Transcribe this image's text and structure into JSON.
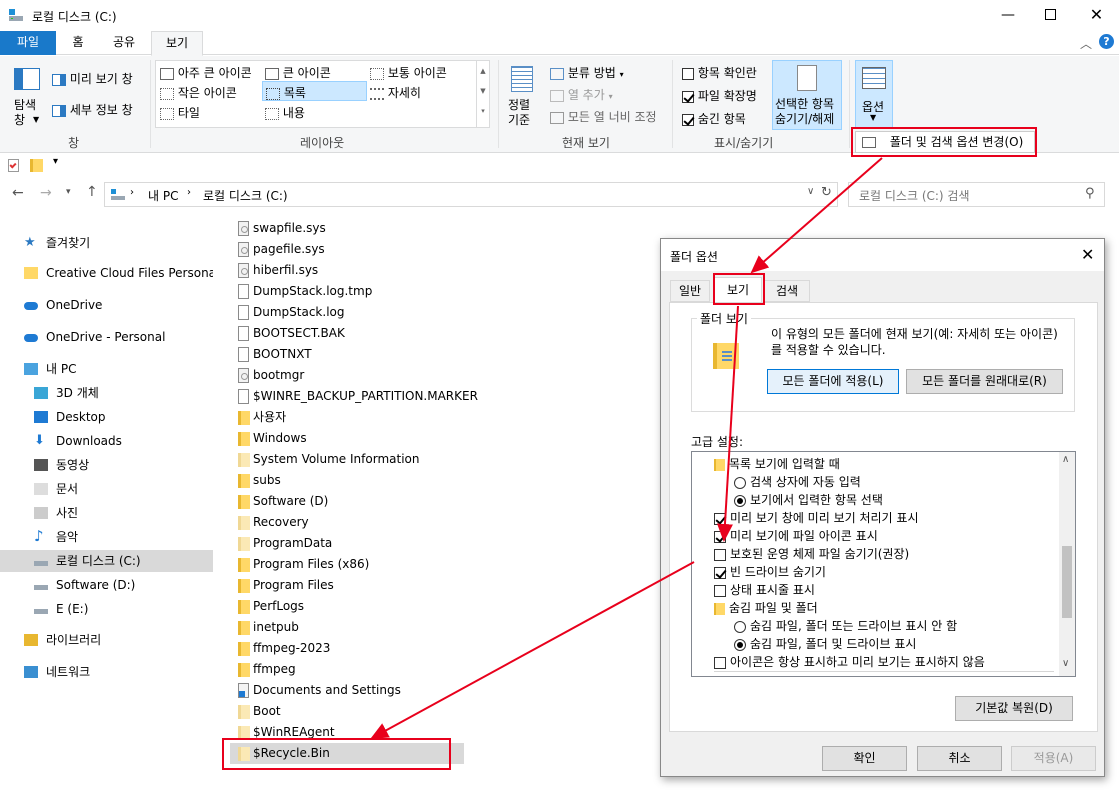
{
  "window": {
    "title": "로컬 디스크 (C:)"
  },
  "ribbon_tabs": [
    "파일",
    "홈",
    "공유",
    "보기"
  ],
  "ribbon": {
    "pane": {
      "nav_pane": "탐색\n창",
      "preview_pane": "미리 보기 창",
      "details_pane": "세부 정보 창",
      "group": "창"
    },
    "layout": {
      "items": [
        "아주 큰 아이콘",
        "큰 아이콘",
        "보통 아이콘",
        "작은 아이콘",
        "목록",
        "자세히",
        "타일",
        "내용"
      ],
      "selected": "목록",
      "group": "레이아웃"
    },
    "current_view": {
      "sort": "정렬\n기준",
      "group_by": "분류 방법",
      "add_col": "열 추가",
      "fit_cols": "모든 열 너비 조정",
      "group": "현재 보기"
    },
    "show_hide": {
      "item_checkbox": "항목 확인란",
      "file_ext": "파일 확장명",
      "hidden_items": "숨긴 항목",
      "hide_selected": "선택한 항목\n숨기기/해제",
      "group": "표시/숨기기",
      "item_checkbox_on": false,
      "file_ext_on": true,
      "hidden_items_on": true
    },
    "options": {
      "label": "옵션",
      "dropdown_item": "폴더 및 검색 옵션 변경(O)"
    }
  },
  "address": {
    "crumbs": [
      "내 PC",
      "로컬 디스크 (C:)"
    ],
    "search_placeholder": "로컬 디스크 (C:) 검색"
  },
  "nav": [
    {
      "label": "즐겨찾기",
      "icon": "star-icon"
    },
    {
      "label": "Creative Cloud Files Personal A",
      "icon": "folder-icon"
    },
    {
      "label": "OneDrive",
      "icon": "cloud-icon"
    },
    {
      "label": "OneDrive - Personal",
      "icon": "cloud-icon"
    },
    {
      "label": "내 PC",
      "icon": "pc-icon"
    },
    {
      "label": "3D 개체",
      "icon": "cube-icon"
    },
    {
      "label": "Desktop",
      "icon": "desktop-icon"
    },
    {
      "label": "Downloads",
      "icon": "download-icon"
    },
    {
      "label": "동영상",
      "icon": "video-icon"
    },
    {
      "label": "문서",
      "icon": "document-icon"
    },
    {
      "label": "사진",
      "icon": "picture-icon"
    },
    {
      "label": "음악",
      "icon": "music-icon"
    },
    {
      "label": "로컬 디스크 (C:)",
      "icon": "drive-icon"
    },
    {
      "label": "Software (D:)",
      "icon": "drive-icon"
    },
    {
      "label": "E (E:)",
      "icon": "drive-icon"
    },
    {
      "label": "라이브러리",
      "icon": "library-icon"
    },
    {
      "label": "네트워크",
      "icon": "network-icon"
    }
  ],
  "files": [
    {
      "name": "swapfile.sys",
      "type": "sys"
    },
    {
      "name": "pagefile.sys",
      "type": "sys"
    },
    {
      "name": "hiberfil.sys",
      "type": "sys"
    },
    {
      "name": "DumpStack.log.tmp",
      "type": "doc"
    },
    {
      "name": "DumpStack.log",
      "type": "doc"
    },
    {
      "name": "BOOTSECT.BAK",
      "type": "doc"
    },
    {
      "name": "BOOTNXT",
      "type": "doc"
    },
    {
      "name": "bootmgr",
      "type": "sys"
    },
    {
      "name": "$WINRE_BACKUP_PARTITION.MARKER",
      "type": "doc"
    },
    {
      "name": "사용자",
      "type": "folder"
    },
    {
      "name": "Windows",
      "type": "folder"
    },
    {
      "name": "System Volume Information",
      "type": "pale"
    },
    {
      "name": "subs",
      "type": "folder"
    },
    {
      "name": "Software (D)",
      "type": "folder"
    },
    {
      "name": "Recovery",
      "type": "pale"
    },
    {
      "name": "ProgramData",
      "type": "pale"
    },
    {
      "name": "Program Files (x86)",
      "type": "folder"
    },
    {
      "name": "Program Files",
      "type": "folder"
    },
    {
      "name": "PerfLogs",
      "type": "folder"
    },
    {
      "name": "inetpub",
      "type": "folder"
    },
    {
      "name": "ffmpeg-2023",
      "type": "folder"
    },
    {
      "name": "ffmpeg",
      "type": "folder"
    },
    {
      "name": "Documents and Settings",
      "type": "shortcut"
    },
    {
      "name": "Boot",
      "type": "pale"
    },
    {
      "name": "$WinREAgent",
      "type": "pale"
    },
    {
      "name": "$Recycle.Bin",
      "type": "pale"
    }
  ],
  "dialog": {
    "title": "폴더 옵션",
    "tabs": [
      "일반",
      "보기",
      "검색"
    ],
    "folder_view": {
      "legend": "폴더 보기",
      "desc": "이 유형의 모든 폴더에 현재 보기(예: 자세히 또는 아이콘)를 적용할 수 있습니다.",
      "apply_btn": "모든 폴더에 적용(L)",
      "reset_btn": "모든 폴더를 원래대로(R)"
    },
    "advanced_label": "고급 설정:",
    "settings": [
      {
        "kind": "folder",
        "label": "목록 보기에 입력할 때",
        "indent": 0
      },
      {
        "kind": "radio",
        "label": "검색 상자에 자동 입력",
        "on": false,
        "indent": 1
      },
      {
        "kind": "radio",
        "label": "보기에서 입력한 항목 선택",
        "on": true,
        "indent": 1
      },
      {
        "kind": "check",
        "label": "미리 보기 창에 미리 보기 처리기 표시",
        "on": true,
        "indent": 0
      },
      {
        "kind": "check",
        "label": "미리 보기에 파일 아이콘 표시",
        "on": true,
        "indent": 0
      },
      {
        "kind": "check",
        "label": "보호된 운영 체제 파일 숨기기(권장)",
        "on": false,
        "indent": 0
      },
      {
        "kind": "check",
        "label": "빈 드라이브 숨기기",
        "on": true,
        "indent": 0
      },
      {
        "kind": "check",
        "label": "상태 표시줄 표시",
        "on": false,
        "indent": 0
      },
      {
        "kind": "folder",
        "label": "숨김 파일 및 폴더",
        "indent": 0
      },
      {
        "kind": "radio",
        "label": "숨김 파일, 폴더 또는 드라이브 표시 안 함",
        "on": false,
        "indent": 1
      },
      {
        "kind": "radio",
        "label": "숨김 파일, 폴더 및 드라이브 표시",
        "on": true,
        "indent": 1
      },
      {
        "kind": "check",
        "label": "아이콘은 항상 표시하고 미리 보기는 표시하지 않음",
        "on": false,
        "indent": 0
      }
    ],
    "restore_btn": "기본값 복원(D)",
    "ok": "확인",
    "cancel": "취소",
    "apply": "적용(A)"
  }
}
